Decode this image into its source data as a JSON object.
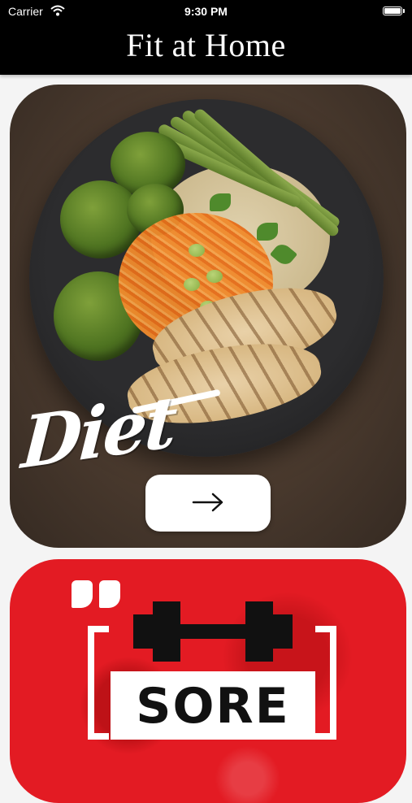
{
  "status_bar": {
    "carrier": "Carrier",
    "time": "9:30 PM"
  },
  "nav": {
    "title": "Fit at Home"
  },
  "diet_card": {
    "label": "Diet",
    "button_icon": "arrow-right-icon"
  },
  "sore_card": {
    "label": "SORE",
    "icon": "dumbbell-icon",
    "accent": "#e31b23"
  }
}
